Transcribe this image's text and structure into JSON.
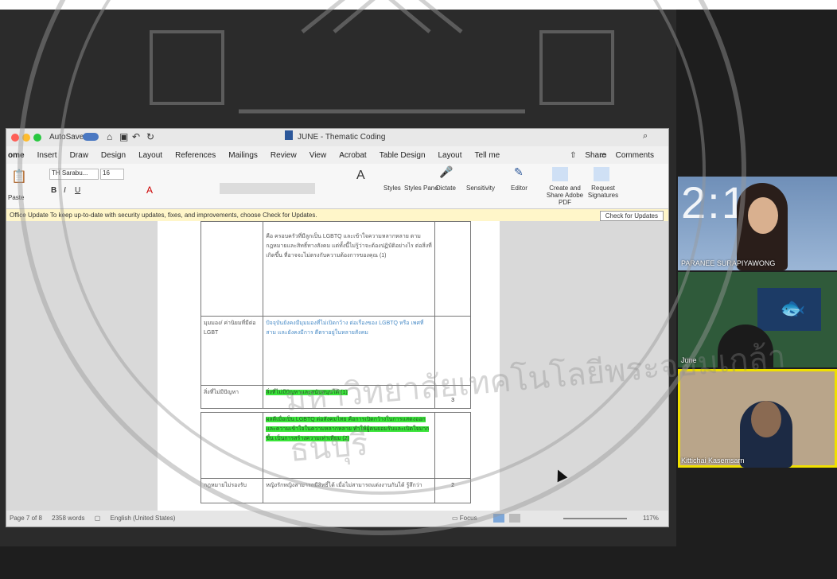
{
  "word": {
    "title": "JUNE - Thematic Coding",
    "autosave": "AutoSave",
    "tabs": [
      "ome",
      "Insert",
      "Draw",
      "Design",
      "Layout",
      "References",
      "Mailings",
      "Review",
      "View",
      "Acrobat",
      "Table Design",
      "Layout",
      "Tell me"
    ],
    "share_label": "Share",
    "comments_label": "Comments",
    "font_name": "TH Sarabu...",
    "font_size": "16",
    "ribbon_right": [
      "Styles",
      "Styles Pane",
      "Dictate",
      "Sensitivity",
      "Editor",
      "Create and Share Adobe PDF",
      "Request Signatures"
    ],
    "paste_label": "Paste",
    "update_message": "Office Update  To keep up-to-date with security updates, fixes, and improvements, choose Check for Updates.",
    "update_button": "Check for Updates",
    "status": {
      "page": "Page 7 of 8",
      "words": "2358 words",
      "language": "English (United States)",
      "focus": "Focus",
      "zoom": "117%"
    },
    "table1": {
      "row1_text": "คือ ครอบครัวที่มีลูกเป็น LGBTQ และเข้าใจความหลากหลาย ตามกฎหมายและสิทธิ์ทางสังคม แต่ทั้งนี้ไม่รู้ว่าจะต้องปฏิบัติอย่างไร ต่อสิ่งที่เกิดขึ้น ที่อาจจะไม่ตรงกับความต้องการของคุณ (1)",
      "row2_label": "มุมมอง/ ค่านิยมที่มีต่อ LGBT",
      "row2_text": "ปัจจุบันยังคงมีมุมมองที่ไม่เปิดกว้าง ต่อเรื่องของ LGBTQ หรือ เพศที่สาม และยังคงมีการ ตีตราอยู่ในหลายสังคม",
      "row3_label": "สิ่งที่ไม่มีปัญหา",
      "row3_text": "สิ่งที่ไม่มีปัญหาและสนับสนุนได้ (1)",
      "row3_num": "3"
    },
    "table2": {
      "row1_text": "ผลดีเมื่อเป็น LGBTQ ต่อสังคมไทย คือการเปิดกว้างในการแสดงออก และความเข้าใจในความหลากหลาย ทำให้ผู้คนยอมรับและเปิดใจมากขึ้น เป็นการสร้างความเท่าเทียม (2)",
      "row2_label": "กฎหมายไม่รองรับ",
      "row2_text": "หญิงรักหญิงสามารถมีสิทธิ์ได้ เมื่อไม่สามารถแต่งงานกันได้ รู้สึกว่า",
      "row2_num": "2"
    }
  },
  "participants": [
    {
      "name": "PARANEE SURAPIYAWONG",
      "clock": "2:15"
    },
    {
      "name": "June"
    },
    {
      "name": "Kittichai Kasemsarn"
    }
  ],
  "watermark": {
    "ring_text": "มหาวิทยาลัยเทคโนโลยีพระจอมเกล้าธนบุรี"
  },
  "colors": {
    "highlight": "#3be53b",
    "active_speaker_border": "#f0e000",
    "update_bar": "#fff6c9"
  }
}
